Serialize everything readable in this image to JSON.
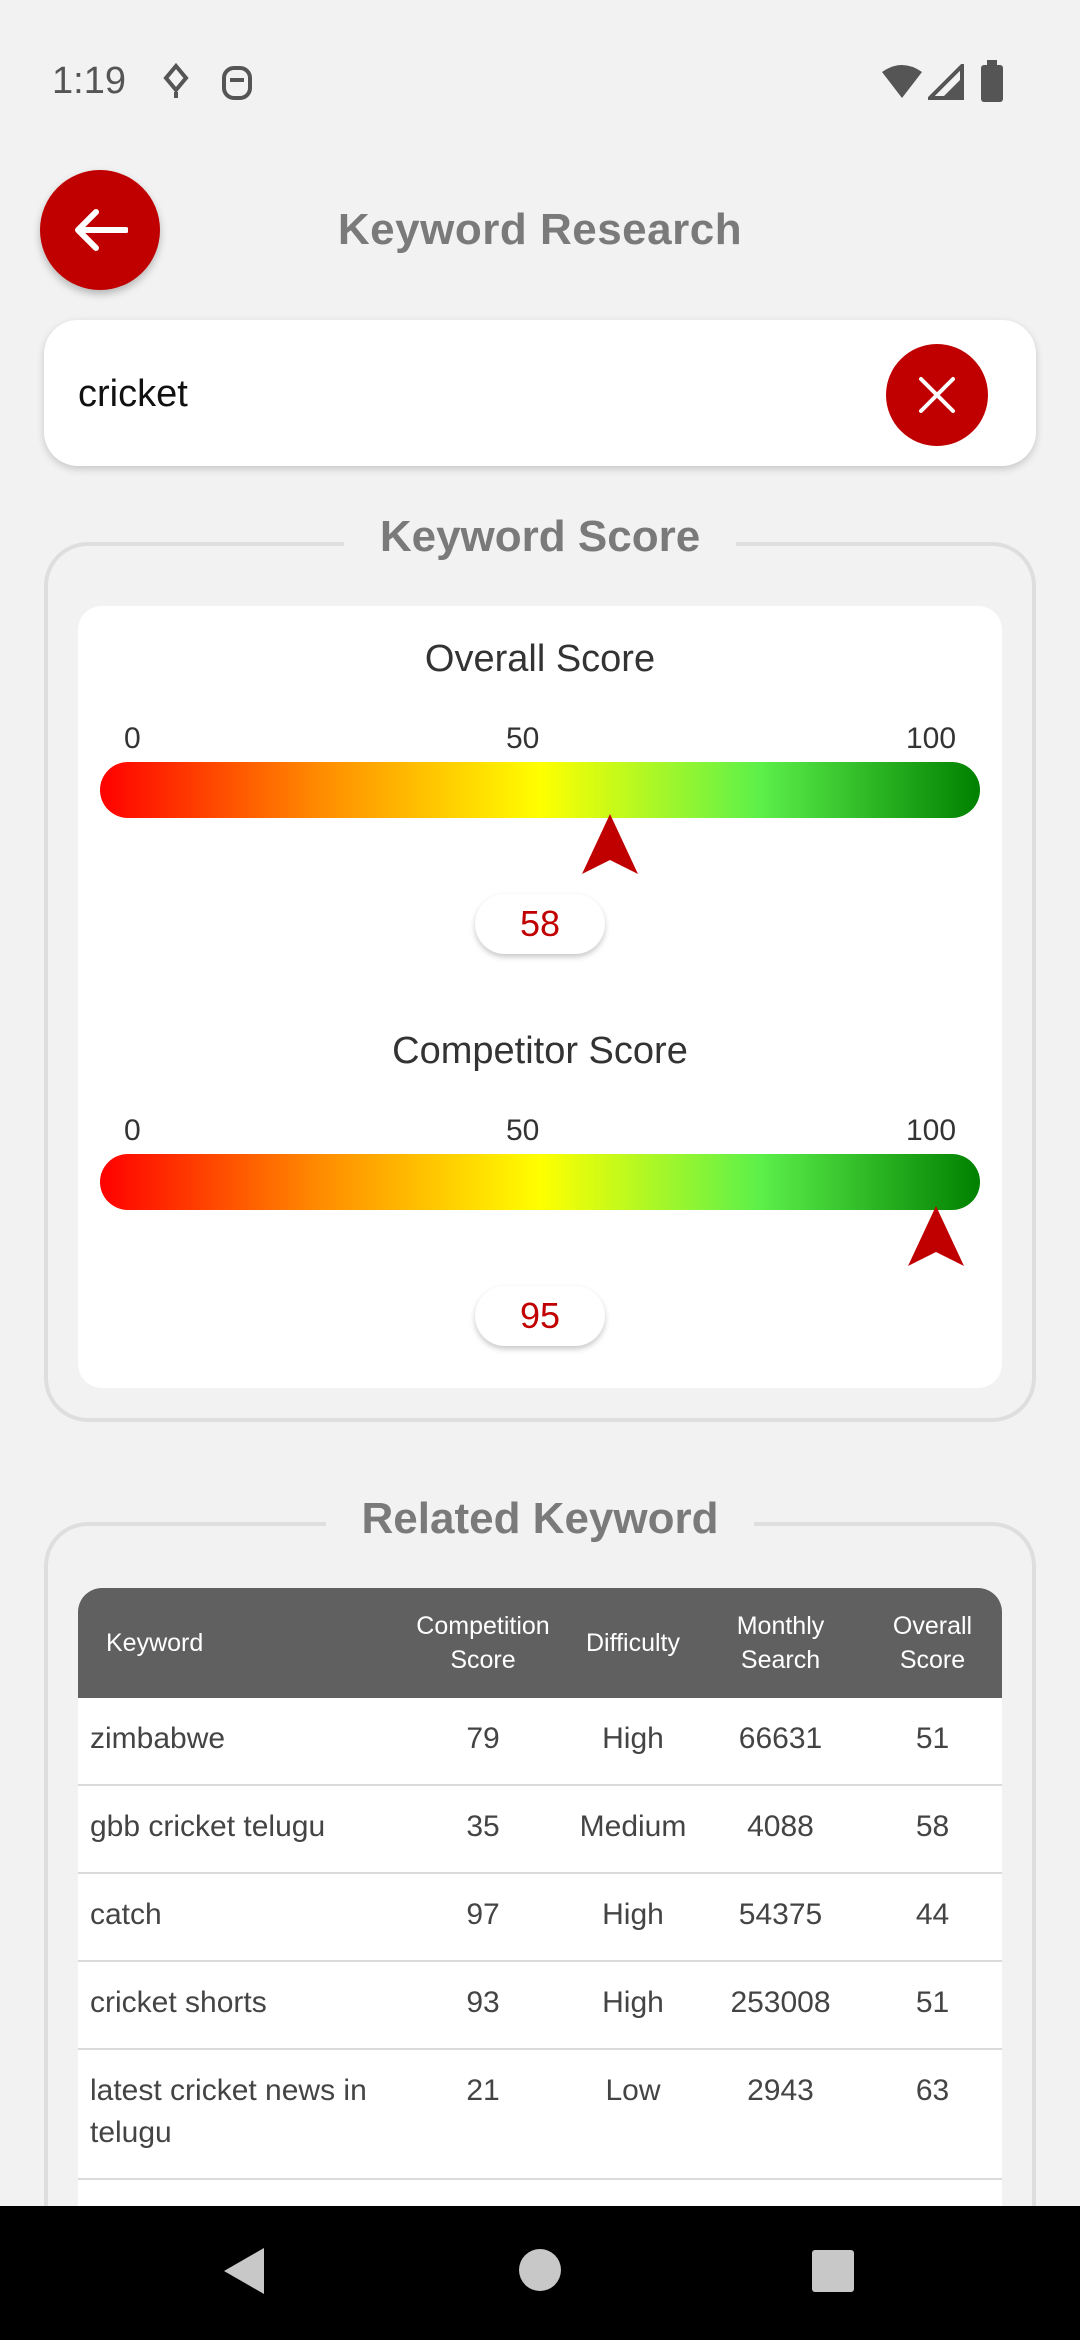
{
  "status_bar": {
    "time": "1:19"
  },
  "header": {
    "title": "Keyword Research"
  },
  "search": {
    "value": "cricket",
    "placeholder": ""
  },
  "keyword_score": {
    "section_title": "Keyword Score",
    "overall": {
      "title": "Overall Score",
      "ticks": [
        "0",
        "50",
        "100"
      ],
      "value": "58",
      "level": 58
    },
    "competitor": {
      "title": "Competitor Score",
      "ticks": [
        "0",
        "50",
        "100"
      ],
      "value": "95",
      "level": 95
    }
  },
  "related": {
    "section_title": "Related Keyword",
    "columns": [
      "Keyword",
      "Competition\nScore",
      "Difficulty",
      "Monthly\nSearch",
      "Overall\nScore"
    ],
    "rows": [
      [
        "zimbabwe",
        "79",
        "High",
        "66631",
        "51"
      ],
      [
        "gbb cricket telugu",
        "35",
        "Medium",
        "4088",
        "58"
      ],
      [
        "catch",
        "97",
        "High",
        "54375",
        "44"
      ],
      [
        "cricket shorts",
        "93",
        "High",
        "253008",
        "51"
      ],
      [
        "latest cricket news in telugu",
        "21",
        "Low",
        "2943",
        "63"
      ]
    ]
  },
  "colors": {
    "accent": "#c00000",
    "table_header": "#606060",
    "background": "#f2f2f2"
  }
}
